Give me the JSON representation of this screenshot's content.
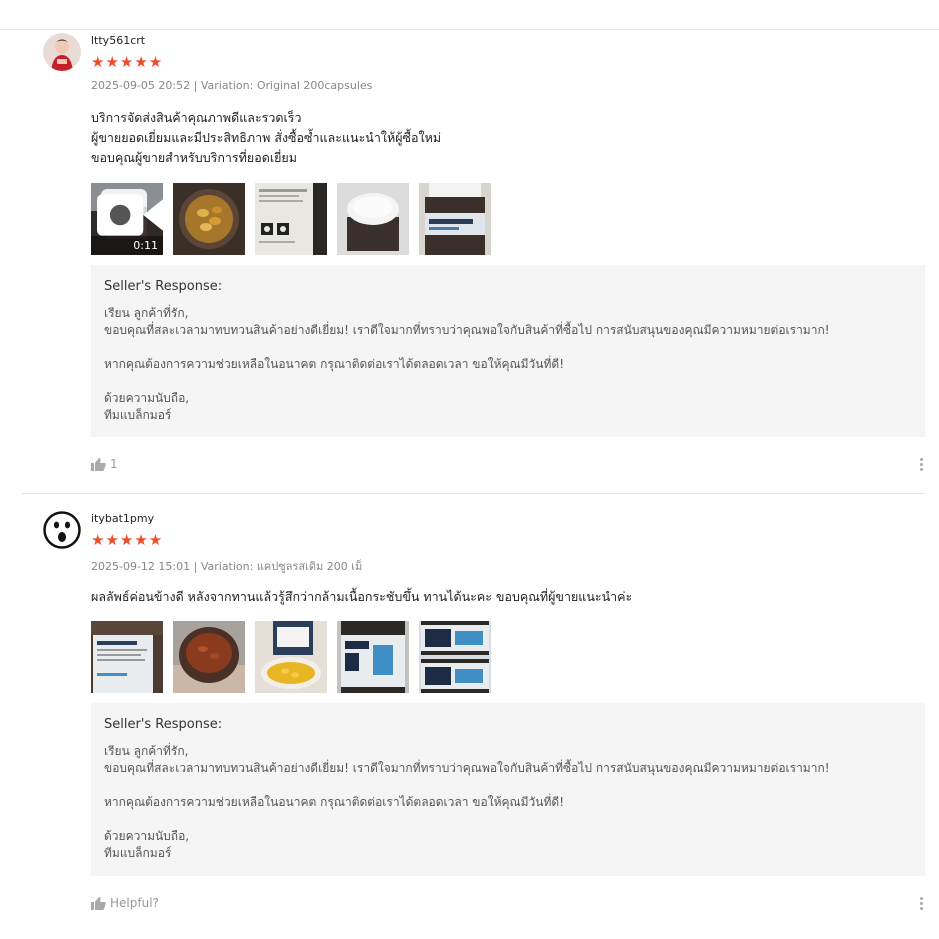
{
  "colors": {
    "star": "#ee4d2d",
    "response_bg": "#f5f5f5",
    "meta": "#888888"
  },
  "reviews": [
    {
      "username": "ltty561crt",
      "stars": "★★★★★",
      "rating": 5,
      "meta": "2025-09-05 20:52 | Variation: Original 200capsules",
      "text": [
        "บริการจัดส่งสินค้าคุณภาพดีและรวดเร็ว",
        "ผู้ขายยอดเยี่ยมและมีประสิทธิภาพ สั่งซื้อซ้ำและแนะนำให้ผู้ซื้อใหม่",
        "ขอบคุณผู้ขายสำหรับบริการที่ยอดเยี่ยม"
      ],
      "video_duration": "0:11",
      "media_icons": [
        "video-thumbnail",
        "photo",
        "photo",
        "photo",
        "photo"
      ],
      "response": {
        "title": "Seller's Response:",
        "lines": [
          "เรียน ลูกค้าที่รัก,",
          "ขอบคุณที่สละเวลามาทบทวนสินค้าอย่างดีเยี่ยม! เราดีใจมากที่ทราบว่าคุณพอใจกับสินค้าที่ซื้อไป การสนับสนุนของคุณมีความหมายต่อเรามาก!",
          "",
          "หากคุณต้องการความช่วยเหลือในอนาคต กรุณาติดต่อเราได้ตลอดเวลา ขอให้คุณมีวันที่ดี!",
          "",
          "ด้วยความนับถือ,",
          "ทีมแบล็กมอร์"
        ]
      },
      "helpful": "1",
      "helpful_icon": "thumbs-up-icon"
    },
    {
      "username": "itybat1pmy",
      "stars": "★★★★★",
      "rating": 5,
      "meta": "2025-09-12 15:01 | Variation: แคปซูลรสเดิม 200 เม็",
      "text": [
        "ผลลัพธ์ค่อนข้างดี หลังจากทานแล้วรู้สึกว่ากล้ามเนื้อกระชับขึ้น ทานได้นะคะ ขอบคุณที่ผู้ขายแนะนำค่ะ"
      ],
      "media_icons": [
        "photo",
        "photo",
        "photo",
        "photo",
        "photo"
      ],
      "response": {
        "title": "Seller's Response:",
        "lines": [
          "เรียน ลูกค้าที่รัก,",
          "ขอบคุณที่สละเวลามาทบทวนสินค้าอย่างดีเยี่ยม! เราดีใจมากที่ทราบว่าคุณพอใจกับสินค้าที่ซื้อไป การสนับสนุนของคุณมีความหมายต่อเรามาก!",
          "",
          "หากคุณต้องการความช่วยเหลือในอนาคต กรุณาติดต่อเราได้ตลอดเวลา ขอให้คุณมีวันที่ดี!",
          "",
          "ด้วยความนับถือ,",
          "ทีมแบล็กมอร์"
        ]
      },
      "helpful": "Helpful?",
      "helpful_icon": "thumbs-up-icon"
    }
  ]
}
